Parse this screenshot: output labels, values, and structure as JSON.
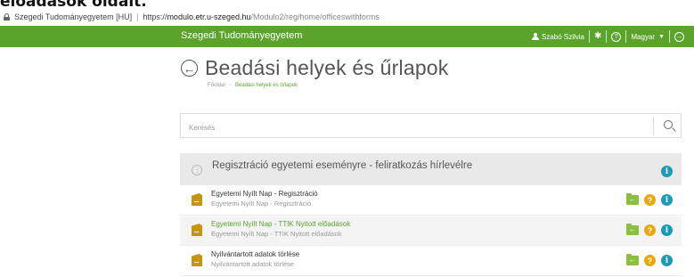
{
  "partial_heading": "előadások oldalt.",
  "browser": {
    "site_name": "Szegedi Tudományegyetem [HU]",
    "url_scheme": "https://",
    "url_host": "modulo.etr.u-szeged.hu",
    "url_path": "/Modulo2/reg/home/officeswithforms"
  },
  "topbar": {
    "brand": "Szegedi Tudományegyetem",
    "user_name": "Szabó Szilvia",
    "language": "Magyar",
    "bg_color": "#5ba42c"
  },
  "page": {
    "title": "Beadási helyek és űrlapok",
    "breadcrumb_home": "Főoldal",
    "breadcrumb_current": "Beadási helyek és űrlapok"
  },
  "search": {
    "placeholder": "Keresés"
  },
  "category": {
    "title": "Regisztráció egyetemi eseményre - feliratkozás hírlevélre"
  },
  "rows": [
    {
      "title": "Egyetemi Nyílt Nap - Regisztráció",
      "subtitle": "Egyetemi Nyílt Nap - Regisztráció"
    },
    {
      "title": "Egyetemi Nyílt Nap - TTIK Nyitott előadások",
      "subtitle": "Egyetemi Nyílt Nap - TTIK Nyitott előadások"
    },
    {
      "title": "Nyilvántartott adatok törlése",
      "subtitle": "Nyilvántartott adatok törlése"
    }
  ],
  "icons": {
    "info": "info-icon",
    "help": "question-mark-icon",
    "folder": "folder-arrow-icon",
    "document": "document-icon"
  }
}
